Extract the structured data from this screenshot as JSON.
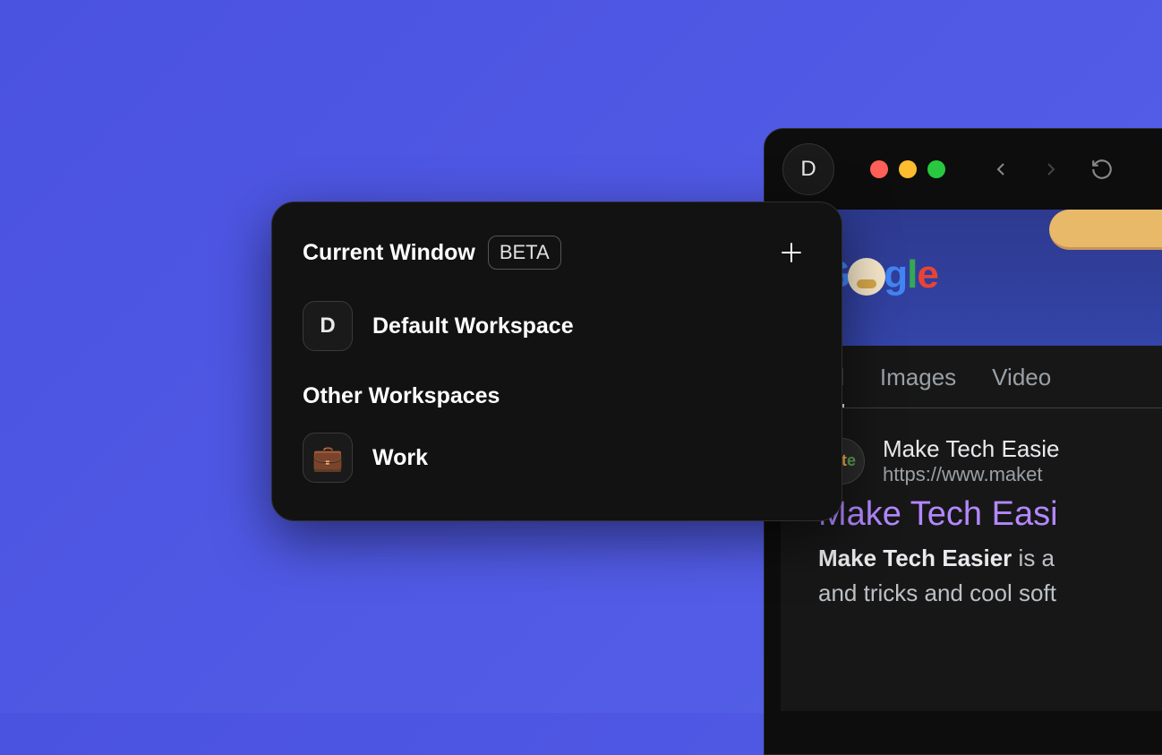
{
  "browser": {
    "workspace_badge_letter": "D",
    "tabs": {
      "all": "All",
      "images": "Images",
      "videos": "Video"
    },
    "result": {
      "site_name": "Make Tech Easie",
      "url": "https://www.maket",
      "title": "Make Tech Easi",
      "snippet_bold": "Make Tech Easier",
      "snippet_rest_1": " is a",
      "snippet_line2": "and tricks and cool soft"
    }
  },
  "popup": {
    "header_title": "Current Window",
    "beta_label": "BETA",
    "current_workspace": {
      "icon_letter": "D",
      "label": "Default Workspace"
    },
    "other_heading": "Other Workspaces",
    "other_workspaces": [
      {
        "emoji": "💼",
        "label": "Work"
      }
    ]
  }
}
